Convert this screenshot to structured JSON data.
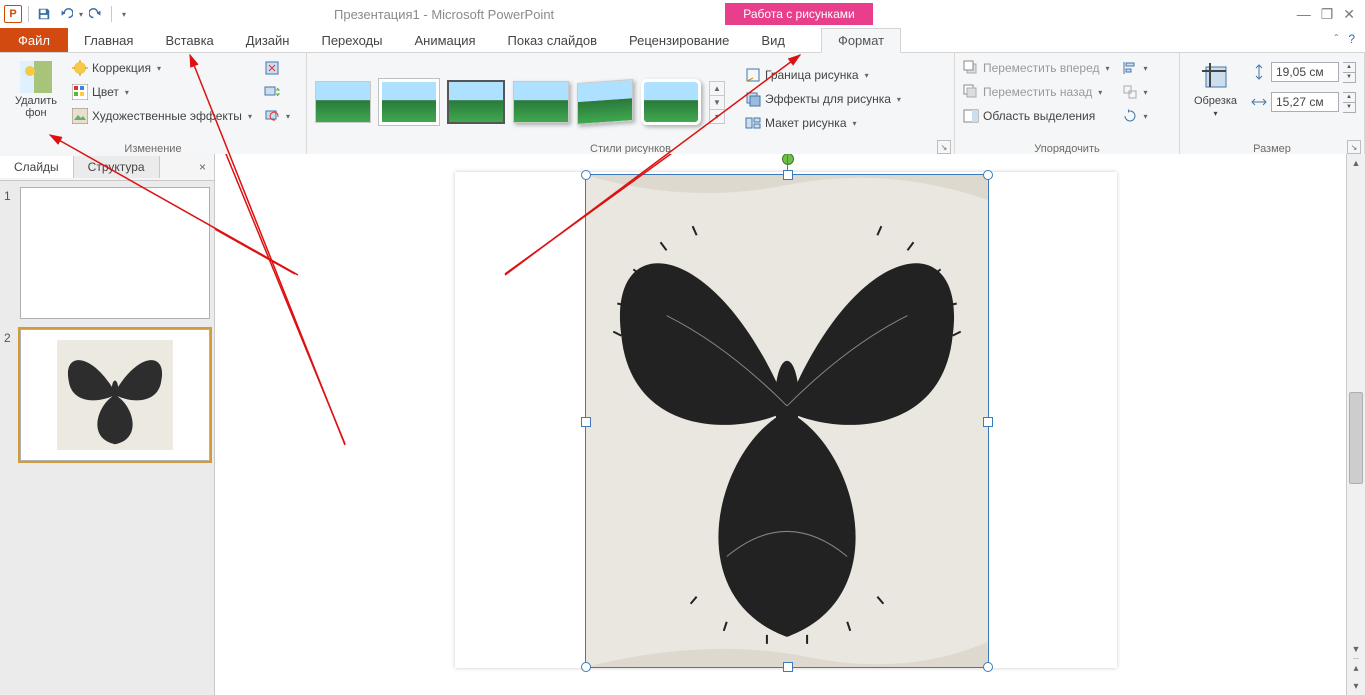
{
  "title": "Презентация1 - Microsoft PowerPoint",
  "contextual_tab": "Работа с рисунками",
  "tabs": {
    "file": "Файл",
    "home": "Главная",
    "insert": "Вставка",
    "design": "Дизайн",
    "transitions": "Переходы",
    "animation": "Анимация",
    "slideshow": "Показ слайдов",
    "review": "Рецензирование",
    "view": "Вид",
    "format": "Формат"
  },
  "ribbon": {
    "remove_bg": "Удалить фон",
    "corrections": "Коррекция",
    "color": "Цвет",
    "artistic": "Художественные эффекты",
    "group_adjust": "Изменение",
    "group_styles": "Стили рисунков",
    "border": "Граница рисунка",
    "effects": "Эффекты для рисунка",
    "layout": "Макет рисунка",
    "bring_forward": "Переместить вперед",
    "send_backward": "Переместить назад",
    "selection_pane": "Область выделения",
    "group_arrange": "Упорядочить",
    "crop": "Обрезка",
    "group_size": "Размер",
    "height_value": "19,05 см",
    "width_value": "15,27 см"
  },
  "left_pane": {
    "tab_slides": "Слайды",
    "tab_outline": "Структура",
    "slide1_num": "1",
    "slide2_num": "2"
  }
}
